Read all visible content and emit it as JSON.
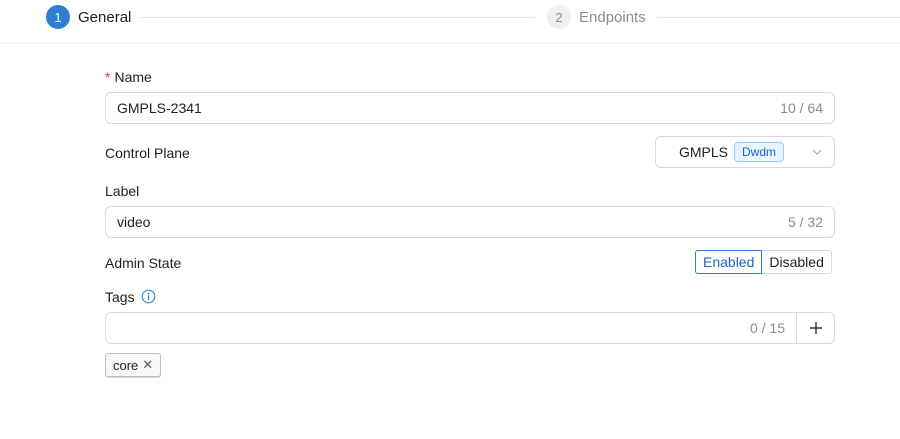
{
  "steps": [
    {
      "number": "1",
      "label": "General"
    },
    {
      "number": "2",
      "label": "Endpoints"
    }
  ],
  "form": {
    "name": {
      "required_mark": "*",
      "label": "Name",
      "value": "GMPLS-2341",
      "counter": "10 / 64"
    },
    "control_plane": {
      "label": "Control Plane",
      "value": "GMPLS",
      "badge": "Dwdm"
    },
    "label_field": {
      "label": "Label",
      "value": "video",
      "counter": "5 / 32"
    },
    "admin_state": {
      "label": "Admin State",
      "options": [
        "Enabled",
        "Disabled"
      ],
      "selected": "Enabled"
    },
    "tags": {
      "label": "Tags",
      "counter": "0 / 15",
      "items": [
        {
          "label": "core"
        }
      ]
    }
  },
  "colors": {
    "accent": "#2f7fd0",
    "required": "#e0362c",
    "badge_bg": "#e8f3ff"
  }
}
